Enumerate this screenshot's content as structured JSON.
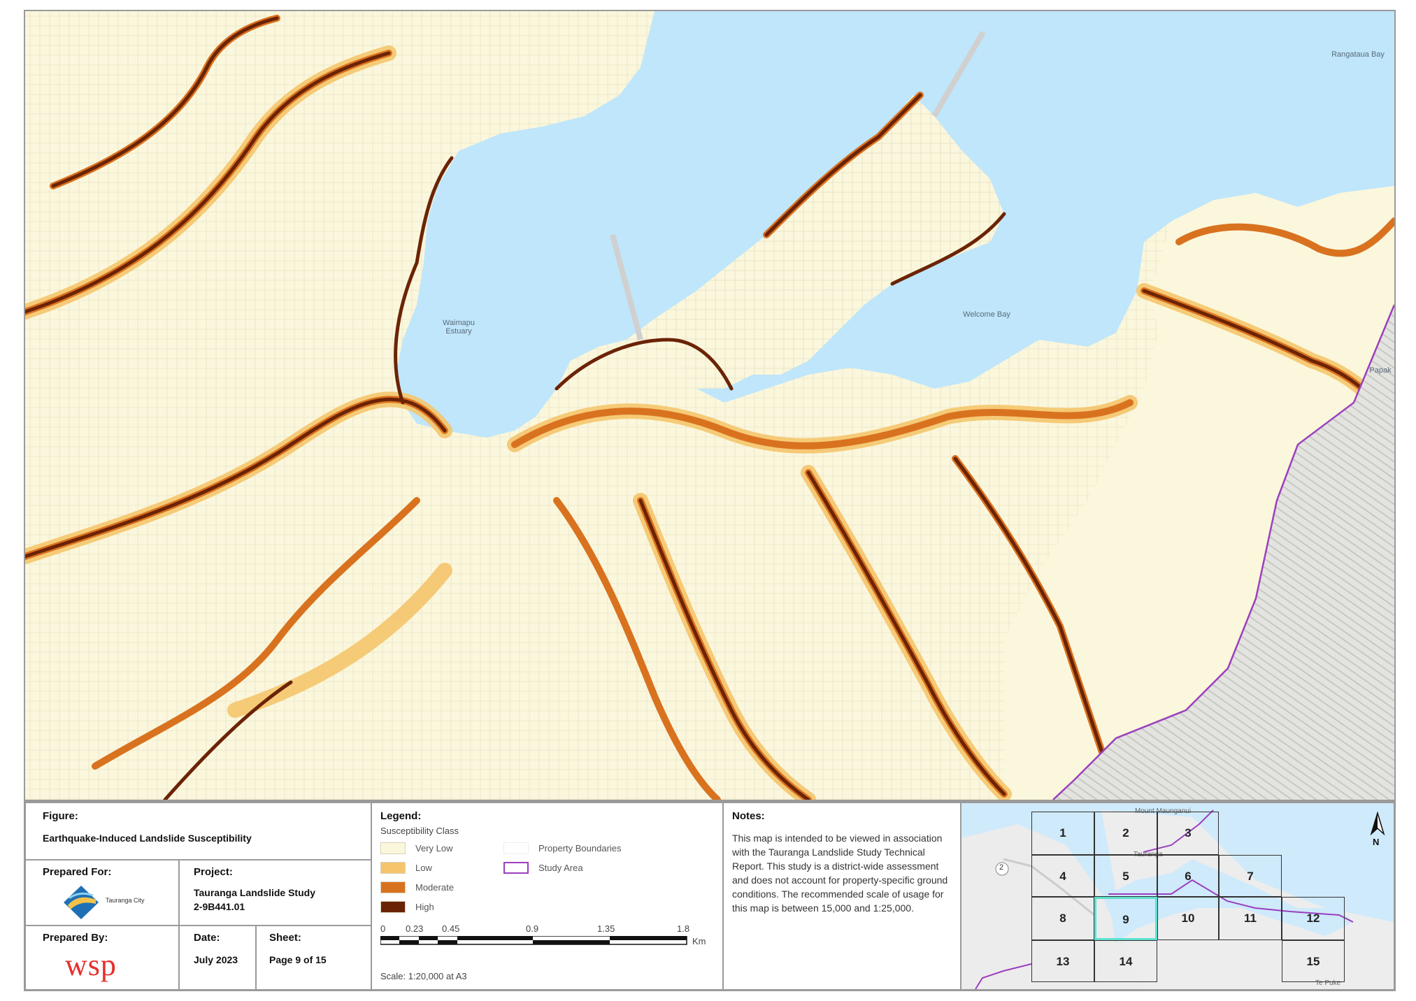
{
  "map": {
    "water_labels": [
      {
        "id": "waimapu",
        "text": "Waimapu Estuary"
      },
      {
        "id": "welcome",
        "text": "Welcome Bay"
      },
      {
        "id": "rangataua",
        "text": "Rangataua Bay"
      }
    ],
    "edge_label": "Papak",
    "colors": {
      "water": "#bfe6fb",
      "very_low": "#fbf7dc",
      "low": "#f5c56c",
      "moderate": "#d9721f",
      "high": "#6b2306",
      "study_area": "#9b3fbf",
      "hillshade": "#d9d9d4"
    }
  },
  "panel": {
    "figure": {
      "header": "Figure:",
      "title": "Earthquake-Induced Landslide Susceptibility"
    },
    "prepared_for": {
      "header": "Prepared For:",
      "org_icon": "tauranga-city-logo-icon",
      "org_name": "Tauranga City"
    },
    "project": {
      "header": "Project:",
      "name": "Tauranga Landslide Study",
      "number": "2-9B441.01"
    },
    "prepared_by": {
      "header": "Prepared By:",
      "logo_text": "wsp"
    },
    "date": {
      "header": "Date:",
      "value": "July 2023"
    },
    "sheet": {
      "header": "Sheet:",
      "value": "Page 9 of 15"
    },
    "legend": {
      "header": "Legend:",
      "subheader": "Susceptibility Class",
      "classes": [
        {
          "label": "Very Low",
          "color": "#fbf7dc"
        },
        {
          "label": "Low",
          "color": "#f5c56c"
        },
        {
          "label": "Moderate",
          "color": "#d9721f"
        },
        {
          "label": "High",
          "color": "#6b2306"
        }
      ],
      "other": [
        {
          "label": "Property Boundaries",
          "color": "#eeeeee"
        },
        {
          "label": "Study Area",
          "color": "#9b3fbf"
        }
      ],
      "scale_ticks": [
        "0",
        "0.23",
        "0.45",
        "0.9",
        "1.35",
        "1.8"
      ],
      "scale_unit": "Km",
      "scale_text": "Scale: 1:20,000 at A3"
    },
    "notes": {
      "header": "Notes:",
      "text": "This map is intended to be viewed in association with the Tauranga Landslide Study Technical Report. This study is a district-wide assessment and does not account for property-specific ground conditions. The recommended scale of usage for this map is between 15,000 and 1:25,000."
    },
    "inset": {
      "sheets": [
        "1",
        "2",
        "3",
        "4",
        "5",
        "6",
        "7",
        "8",
        "9",
        "10",
        "11",
        "12",
        "13",
        "14",
        "15"
      ],
      "active_sheet": "9",
      "north_label": "N",
      "road_label": "2",
      "place_labels": [
        "Mount Maunganui",
        "Tauranga",
        "Te Puke"
      ]
    }
  }
}
